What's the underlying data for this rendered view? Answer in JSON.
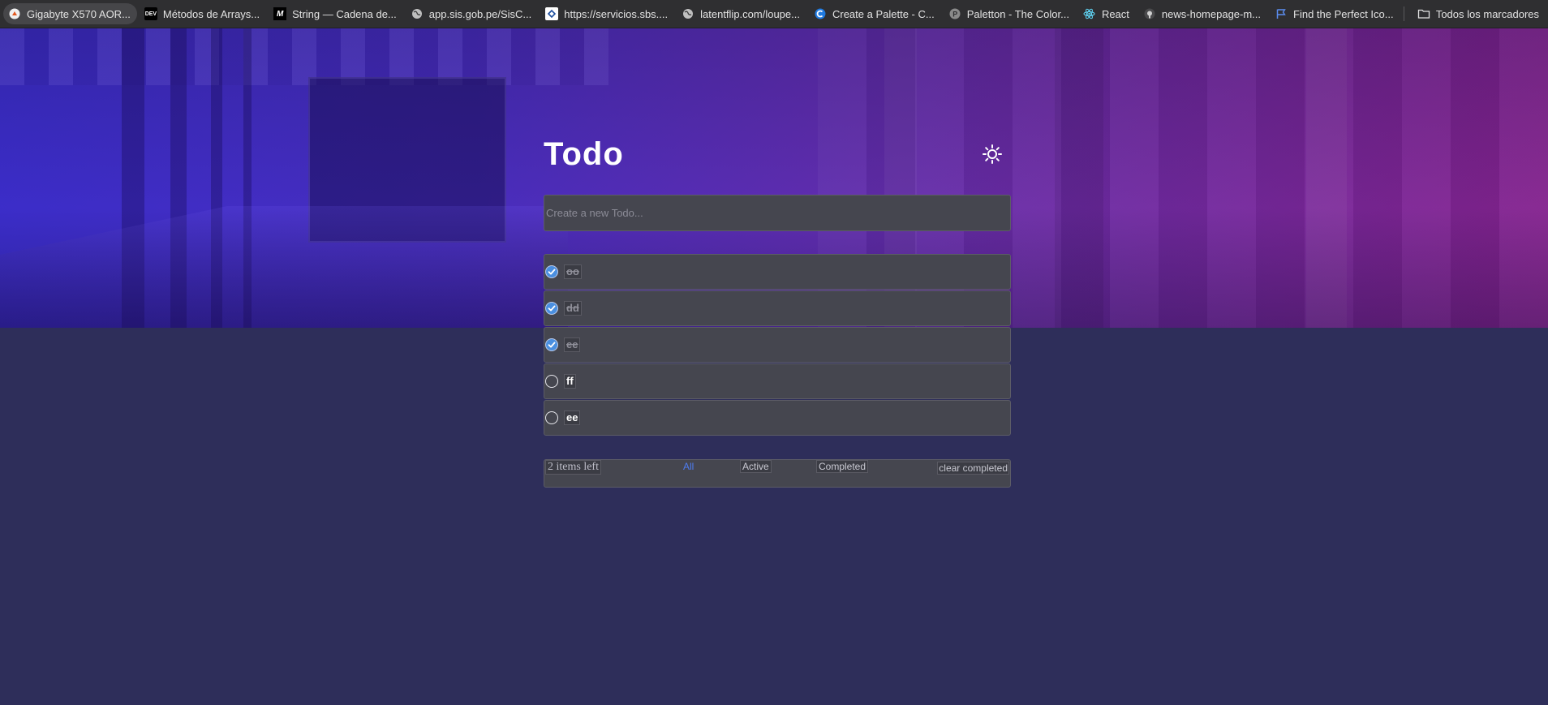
{
  "bookmarks": [
    {
      "label": "Gigabyte X570 AOR...",
      "icon": "aorus-icon"
    },
    {
      "label": "Métodos de Arrays...",
      "icon": "dev-icon"
    },
    {
      "label": "String — Cadena de...",
      "icon": "mdn-icon"
    },
    {
      "label": "app.sis.gob.pe/SisC...",
      "icon": "globe-icon"
    },
    {
      "label": "https://servicios.sbs....",
      "icon": "sbs-icon"
    },
    {
      "label": "latentflip.com/loupe...",
      "icon": "globe-icon"
    },
    {
      "label": "Create a Palette - C...",
      "icon": "coolors-icon"
    },
    {
      "label": "Paletton - The Color...",
      "icon": "paletton-icon"
    },
    {
      "label": "React",
      "icon": "react-icon"
    },
    {
      "label": "news-homepage-m...",
      "icon": "github-icon"
    },
    {
      "label": "Find the Perfect Ico...",
      "icon": "flag-icon"
    }
  ],
  "all_bookmarks_label": "Todos los marcadores",
  "app": {
    "title": "Todo",
    "theme_icon": "sun-icon",
    "new_todo_placeholder": "Create a new Todo...",
    "todos": [
      {
        "text": "oo",
        "completed": true
      },
      {
        "text": "dd",
        "completed": true
      },
      {
        "text": "ee",
        "completed": true
      },
      {
        "text": "ff",
        "completed": false
      },
      {
        "text": "ee",
        "completed": false
      }
    ],
    "footer": {
      "items_left": "2 items left",
      "filters": [
        "All",
        "Active",
        "Completed"
      ],
      "active_filter": "All",
      "clear_label": "clear completed"
    }
  },
  "colors": {
    "page_bg": "#2e2e5a",
    "card_bg": "#45464f",
    "active_filter": "#4d7cf0",
    "check_blue": "#4a8fe0"
  }
}
